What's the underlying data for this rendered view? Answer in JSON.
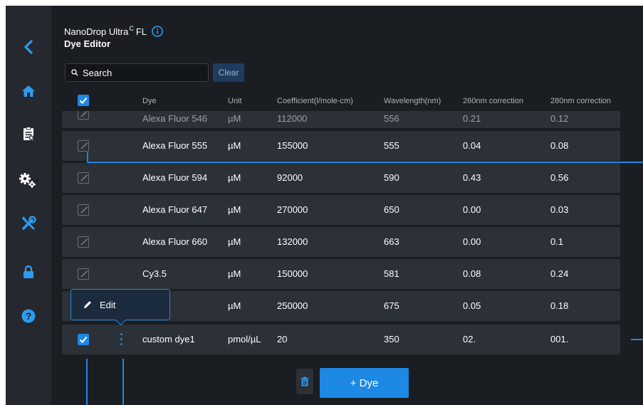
{
  "app": {
    "name": "NanoDrop Ultra",
    "name_sup": "C",
    "name_suffix": "FL",
    "page_title": "Dye Editor"
  },
  "search": {
    "placeholder": "Search",
    "value": "",
    "clear_label": "Clear"
  },
  "table": {
    "columns": [
      "Dye",
      "Unit",
      "Coefficient(l/mole-cm)",
      "Wavelength(nm)",
      "260nm correction",
      "280nm correction"
    ],
    "rows": [
      {
        "dye": "Alexa Fluor 546",
        "unit": "µM",
        "coefficient": "112000",
        "wavelength": "556",
        "c260": "0.21",
        "c280": "0.12"
      },
      {
        "dye": "Alexa Fluor 555",
        "unit": "µM",
        "coefficient": "155000",
        "wavelength": "555",
        "c260": "0.04",
        "c280": "0.08"
      },
      {
        "dye": "Alexa Fluor 594",
        "unit": "µM",
        "coefficient": "92000",
        "wavelength": "590",
        "c260": "0.43",
        "c280": "0.56"
      },
      {
        "dye": "Alexa Fluor 647",
        "unit": "µM",
        "coefficient": "270000",
        "wavelength": "650",
        "c260": "0.00",
        "c280": "0.03"
      },
      {
        "dye": "Alexa Fluor 660",
        "unit": "µM",
        "coefficient": "132000",
        "wavelength": "663",
        "c260": "0.00",
        "c280": "0.1"
      },
      {
        "dye": "Cy3.5",
        "unit": "µM",
        "coefficient": "150000",
        "wavelength": "581",
        "c260": "0.08",
        "c280": "0.24"
      },
      {
        "dye": "",
        "unit": "µM",
        "coefficient": "250000",
        "wavelength": "675",
        "c260": "0.05",
        "c280": "0.18"
      },
      {
        "dye": "custom dye1",
        "unit": "pmol/µL",
        "coefficient": "20",
        "wavelength": "350",
        "c260": "02.",
        "c280": "001."
      }
    ]
  },
  "popover": {
    "edit_label": "Edit"
  },
  "actions": {
    "add_dye_label": "+ Dye"
  },
  "sidebar": {
    "items": [
      "back-icon",
      "home-icon",
      "reports-icon",
      "settings-icon",
      "tools-icon",
      "lock-icon",
      "help-icon"
    ]
  },
  "colors": {
    "accent": "#1e88e5",
    "background": "#1a1d22",
    "sidebar": "#25282e",
    "row": "#2c3037"
  }
}
